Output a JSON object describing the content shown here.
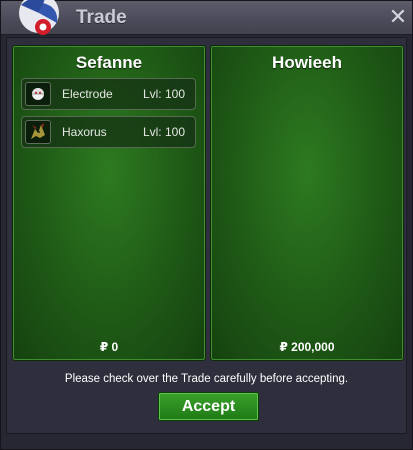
{
  "window": {
    "title": "Trade",
    "close_symbol": "✕"
  },
  "left_panel": {
    "player": "Sefanne",
    "pokemon": [
      {
        "name": "Electrode",
        "level": "Lvl: 100",
        "icon": "electrode-icon"
      },
      {
        "name": "Haxorus",
        "level": "Lvl: 100",
        "icon": "haxorus-icon"
      }
    ],
    "money": "₽ 0"
  },
  "right_panel": {
    "player": "Howieeh",
    "pokemon": [],
    "money": "₽ 200,000"
  },
  "notice": "Please check over the Trade carefully before accepting.",
  "accept_label": "Accept",
  "colors": {
    "panel_green": "#2d7a20",
    "button_green": "#3aa12a",
    "window_bg": "#2e2e3c"
  }
}
